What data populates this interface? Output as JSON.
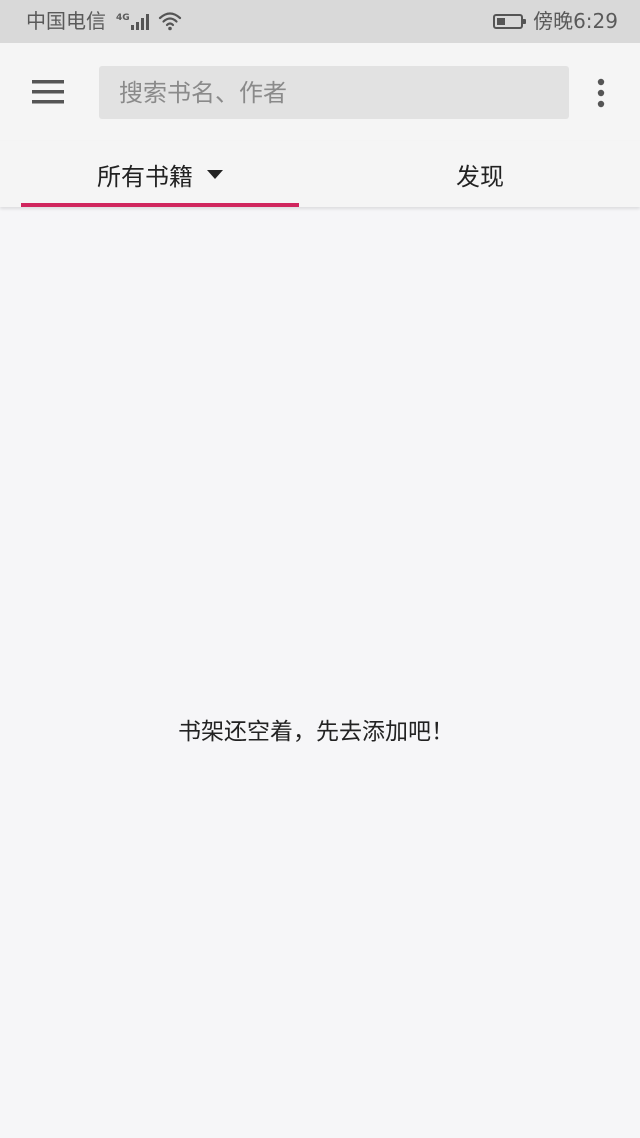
{
  "status_bar": {
    "carrier": "中国电信",
    "network": "4G",
    "time": "傍晚6:29",
    "battery_level": 0.3,
    "icons": [
      "signal-icon",
      "wifi-icon",
      "battery-icon"
    ]
  },
  "toolbar": {
    "menu_icon": "hamburger-menu-icon",
    "search_placeholder": "搜索书名、作者",
    "more_icon": "more-vert-icon"
  },
  "tabs": [
    {
      "label": "所有书籍",
      "active": true,
      "icon": "dropdown-arrow-icon"
    },
    {
      "label": "发现",
      "active": false
    }
  ],
  "empty_state": {
    "message": "书架还空着，先去添加吧！"
  },
  "colors": {
    "accent": "#d0265e",
    "status_bar_bg": "#d9d9d9",
    "toolbar_bg": "#f5f5f5",
    "page_bg": "#f6f6f8",
    "search_bg": "#e2e2e2"
  }
}
